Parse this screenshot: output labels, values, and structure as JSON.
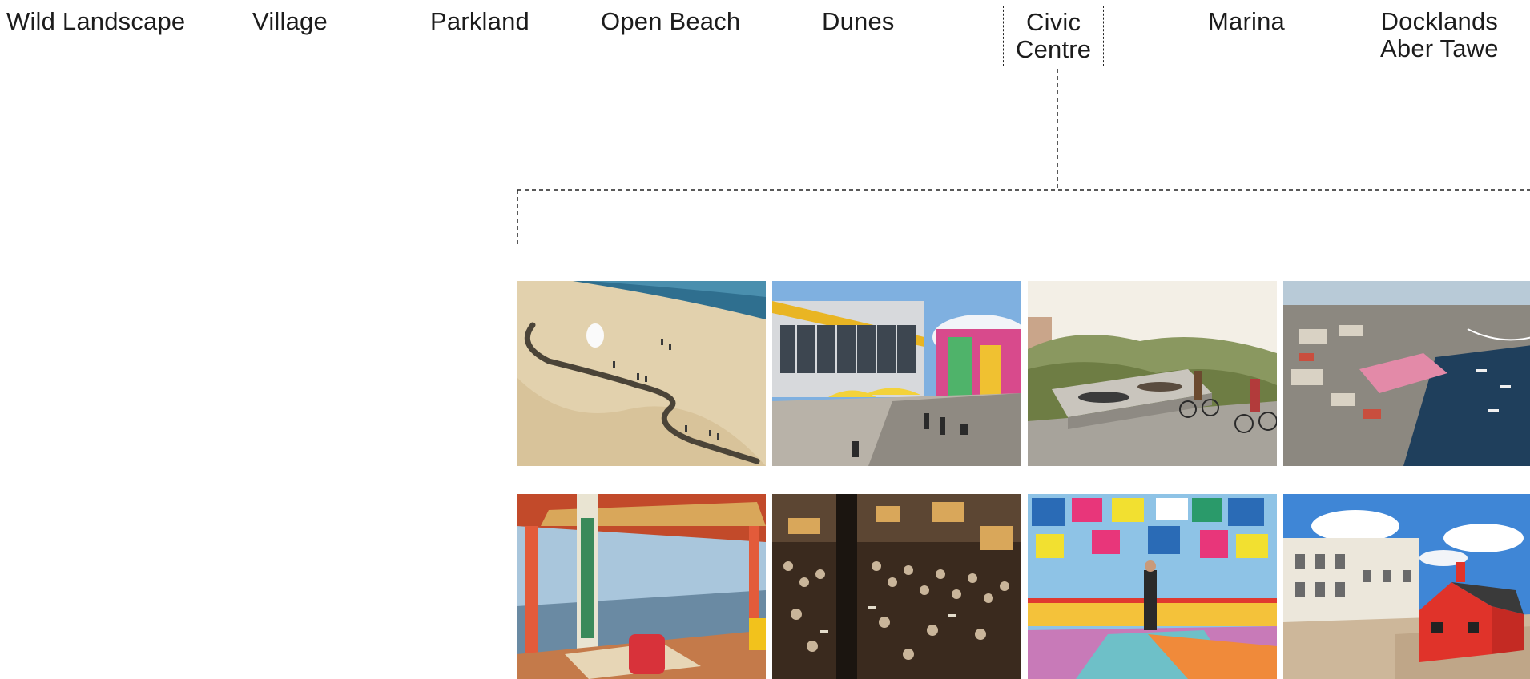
{
  "nav": {
    "items": [
      {
        "id": "wild-landscape",
        "lines": [
          "Wild Landscape"
        ]
      },
      {
        "id": "village",
        "lines": [
          "Village"
        ]
      },
      {
        "id": "parkland",
        "lines": [
          "Parkland"
        ]
      },
      {
        "id": "open-beach",
        "lines": [
          "Open Beach"
        ]
      },
      {
        "id": "dunes",
        "lines": [
          "Dunes"
        ]
      },
      {
        "id": "civic-centre",
        "lines": [
          "Civic",
          "Centre"
        ],
        "active": true
      },
      {
        "id": "marina",
        "lines": [
          "Marina"
        ]
      },
      {
        "id": "docklands-aber-tawe",
        "lines": [
          "Docklands",
          "Aber Tawe"
        ]
      }
    ]
  },
  "gallery": {
    "tiles": [
      {
        "subject": "beach-sand-path-photo"
      },
      {
        "subject": "festival-terrace-photo"
      },
      {
        "subject": "dune-bench-cyclists-photo"
      },
      {
        "subject": "aerial-harbour-photo"
      },
      {
        "subject": "colourful-pavilion-photo"
      },
      {
        "subject": "crowded-market-hall-photo"
      },
      {
        "subject": "poster-pavilion-photo"
      },
      {
        "subject": "red-house-beach-photo"
      }
    ]
  },
  "colors": {
    "text": "#1c1c1c",
    "dashed_line": "#222222"
  }
}
